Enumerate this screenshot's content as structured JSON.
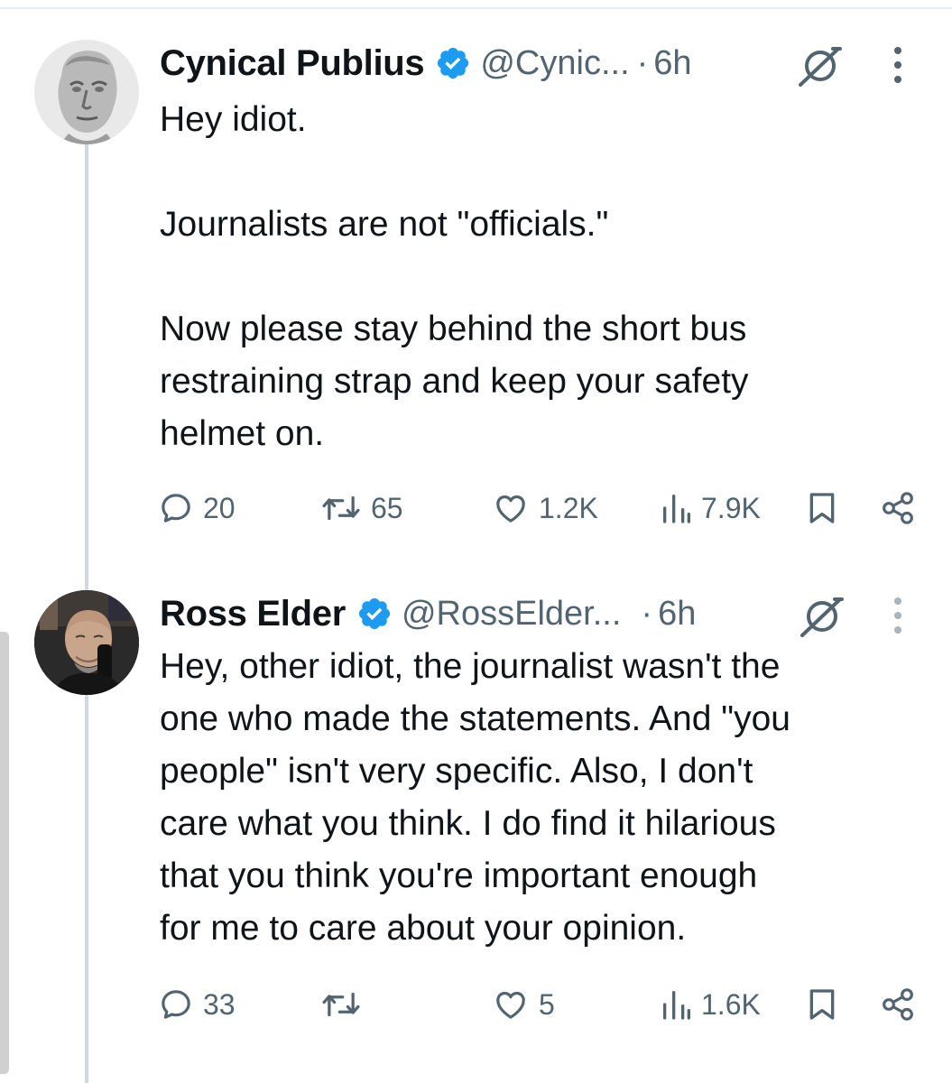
{
  "colors": {
    "text_primary": "#0f1419",
    "text_secondary": "#536471",
    "verified_blue": "#1d9bf0",
    "thread_line": "#cfd9de"
  },
  "tweets": [
    {
      "author": {
        "name": "Cynical Publius",
        "handle": "@Cynic...",
        "verified": true,
        "avatar": "marble-bust-portrait"
      },
      "dot": "·",
      "time": "6h",
      "body": [
        "Hey idiot.",
        "Journalists are not \"officials.\"",
        "Now please stay behind the short bus\nrestraining strap and keep your safety\nhelmet on."
      ],
      "metrics": {
        "replies": "20",
        "reposts": "65",
        "likes": "1.2K",
        "views": "7.9K"
      },
      "icons": [
        "reply-icon",
        "repost-icon",
        "like-icon",
        "views-icon",
        "bookmark-icon",
        "share-icon",
        "grok-icon",
        "more-icon"
      ]
    },
    {
      "author": {
        "name": "Ross Elder",
        "handle": "@RossElder...",
        "verified": true,
        "avatar": "man-with-microphone-portrait"
      },
      "dot": "·",
      "time": "6h",
      "body": [
        "Hey, other idiot, the journalist wasn't the\none who made the statements. And \"you\npeople\" isn't very specific. Also, I don't\ncare what you think. I do find it hilarious\nthat you think you're important enough\nfor me to care about your opinion."
      ],
      "metrics": {
        "replies": "33",
        "reposts": "",
        "likes": "5",
        "views": "1.6K"
      },
      "icons": [
        "reply-icon",
        "repost-icon",
        "like-icon",
        "views-icon",
        "bookmark-icon",
        "share-icon",
        "grok-icon",
        "more-icon"
      ]
    }
  ]
}
